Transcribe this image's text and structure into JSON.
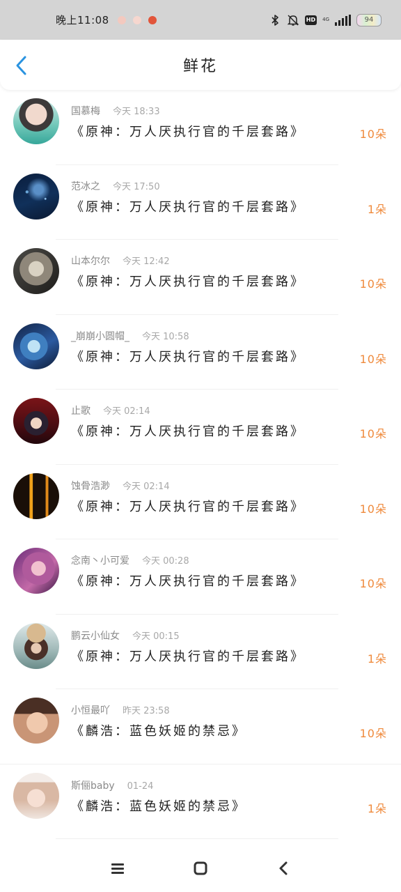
{
  "status_bar": {
    "time": "晚上11:08",
    "hd_label": "HD",
    "network": "4G",
    "battery": "94",
    "icons": [
      "bluetooth-icon",
      "bell-off-icon",
      "hd-icon",
      "signal-icon",
      "battery-icon"
    ]
  },
  "header": {
    "title": "鲜花",
    "back_icon": "chevron-left-icon"
  },
  "colors": {
    "accent_blue": "#2a93e0",
    "count_orange": "#ef8a3c"
  },
  "items": [
    {
      "username": "国慕梅",
      "time": "今天 18:33",
      "book": "《原神：万人厌执行官的千层套路》",
      "count": "10朵"
    },
    {
      "username": "范冰之",
      "time": "今天 17:50",
      "book": "《原神：万人厌执行官的千层套路》",
      "count": "1朵"
    },
    {
      "username": "山本尔尔",
      "time": "今天 12:42",
      "book": "《原神：万人厌执行官的千层套路》",
      "count": "10朵"
    },
    {
      "username": "_崩崩小圆帽_",
      "time": "今天 10:58",
      "book": "《原神：万人厌执行官的千层套路》",
      "count": "10朵"
    },
    {
      "username": "止歌",
      "time": "今天 02:14",
      "book": "《原神：万人厌执行官的千层套路》",
      "count": "10朵"
    },
    {
      "username": "蚀骨浩渺",
      "time": "今天 02:14",
      "book": "《原神：万人厌执行官的千层套路》",
      "count": "10朵"
    },
    {
      "username": "念南丶小可爱",
      "time": "今天 00:28",
      "book": "《原神：万人厌执行官的千层套路》",
      "count": "10朵"
    },
    {
      "username": "鹏云小仙女",
      "time": "今天 00:15",
      "book": "《原神：万人厌执行官的千层套路》",
      "count": "1朵"
    },
    {
      "username": "小恒最吖",
      "time": "昨天 23:58",
      "book": "《麟浩：蓝色妖姬的禁忌》",
      "count": "10朵"
    },
    {
      "username": "斯俪baby",
      "time": "01-24",
      "book": "《麟浩：蓝色妖姬的禁忌》",
      "count": "1朵"
    }
  ],
  "navbar": {
    "icons": [
      "menu-icon",
      "home-square-icon",
      "back-triangle-icon"
    ]
  }
}
